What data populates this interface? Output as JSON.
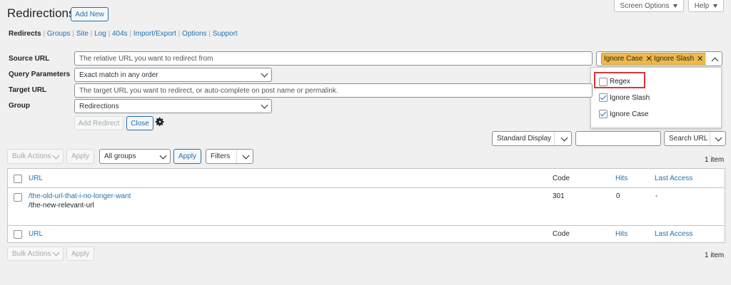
{
  "page": {
    "title": "Redirections",
    "add_new": "Add New"
  },
  "top_tabs": {
    "screen_options": "Screen Options",
    "help": "Help"
  },
  "subnav": {
    "items": [
      "Redirects",
      "Groups",
      "Site",
      "Log",
      "404s",
      "Import/Export",
      "Options",
      "Support"
    ],
    "separator": "|"
  },
  "form": {
    "source_label": "Source URL",
    "source_placeholder": "The relative URL you want to redirect from",
    "tags": [
      "Ignore Case",
      "Ignore Slash"
    ],
    "tag_remove": "✕",
    "query_label": "Query Parameters",
    "query_value": "Exact match in any order",
    "target_label": "Target URL",
    "target_placeholder": "The target URL you want to redirect, or auto-complete on post name or permalink.",
    "group_label": "Group",
    "group_value": "Redirections",
    "add_redirect": "Add Redirect",
    "close": "Close"
  },
  "flags_dropdown": {
    "options": [
      {
        "label": "Regex",
        "checked": false
      },
      {
        "label": "Ignore Slash",
        "checked": true
      },
      {
        "label": "Ignore Case",
        "checked": true
      }
    ],
    "highlight_color": "#d63638"
  },
  "search": {
    "display_select": "Standard Display",
    "search_button": "Search URL"
  },
  "bulk": {
    "bulk_actions": "Bulk Actions",
    "apply": "Apply",
    "groups_select": "All groups",
    "apply_filter": "Apply",
    "filters": "Filters",
    "count_top": "1 item",
    "count_bottom": "1 item"
  },
  "table": {
    "columns": [
      "URL",
      "Code",
      "Hits",
      "Last Access"
    ],
    "rows": [
      {
        "source": "/the-old-url-that-i-no-longer-want",
        "target": "/the-new-relevant-url",
        "code": "301",
        "hits": "0",
        "last_access": "-"
      }
    ]
  },
  "colors": {
    "link": "#2271b1",
    "tag_bg": "#f0b849",
    "background": "#f0f0f1"
  }
}
